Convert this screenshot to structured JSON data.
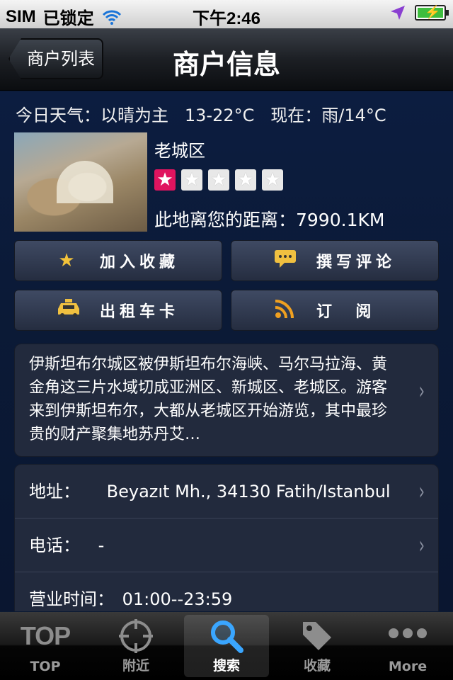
{
  "status_bar": {
    "carrier": "SIM",
    "lock_status": "已锁定",
    "time": "下午2:46"
  },
  "nav": {
    "back_label": "商户列表",
    "title": "商户信息"
  },
  "weather": "今日天气：以晴为主   13-22°C   现在：雨/14°C",
  "place": {
    "name": "老城区",
    "rating": 1,
    "rating_max": 5,
    "distance": "此地离您的距离：7990.1KM"
  },
  "actions": {
    "favorite": "加入收藏",
    "review": "撰写评论",
    "taxi": "出租车卡",
    "subscribe": "订  阅"
  },
  "description": "伊斯坦布尔城区被伊斯坦布尔海峡、马尔马拉海、黄金角这三片水域切成亚洲区、新城区、老城区。游客来到伊斯坦布尔，大都从老城区开始游览，其中最珍贵的财产聚集地苏丹艾…",
  "info": {
    "address_label": "地址：",
    "address_value": "Beyazıt Mh., 34130 Fatih/Istanbul",
    "phone_label": "电话：",
    "phone_value": "-",
    "hours_label": "营业时间：",
    "hours_value": "01:00--23:59"
  },
  "tabs": [
    {
      "label": "TOP",
      "icon": "top-text-icon"
    },
    {
      "label": "附近",
      "icon": "crosshair-icon"
    },
    {
      "label": "搜索",
      "icon": "search-icon"
    },
    {
      "label": "收藏",
      "icon": "tag-icon"
    },
    {
      "label": "More",
      "icon": "more-dots-icon"
    }
  ],
  "active_tab": "搜索",
  "colors": {
    "star_on": "#e0145f",
    "tab_active_icon": "#3aa6ff"
  }
}
